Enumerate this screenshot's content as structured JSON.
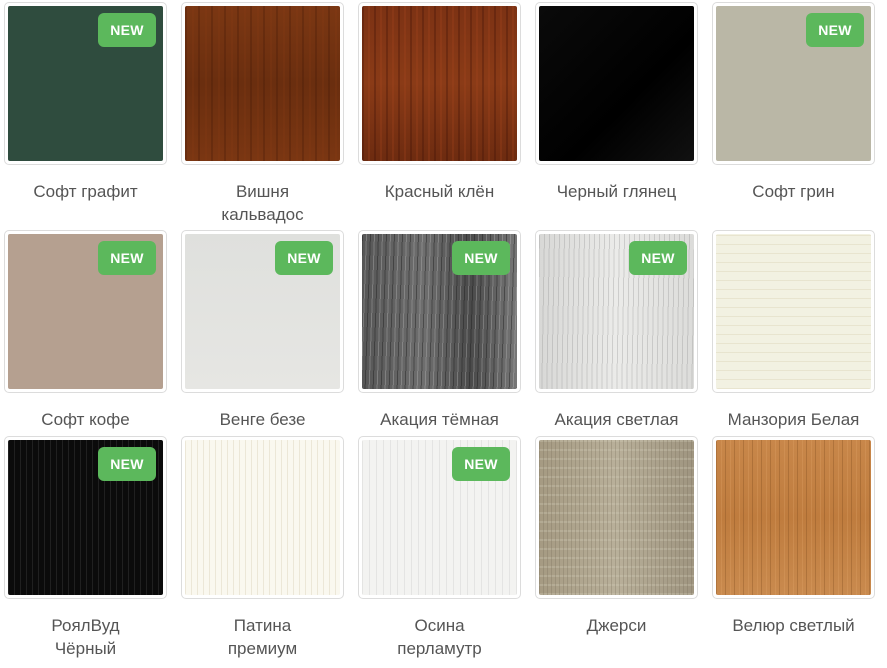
{
  "badge_text": "NEW",
  "badge_color": "#5cb85c",
  "swatches": [
    {
      "label": "Софт графит",
      "new": true,
      "color": "#2f4c3e"
    },
    {
      "label": "Вишня\nкальвадос",
      "new": false,
      "color": "#763412"
    },
    {
      "label": "Красный клён",
      "new": false,
      "color": "#7c3214"
    },
    {
      "label": "Черный глянец",
      "new": false,
      "color": "#000000"
    },
    {
      "label": "Софт грин",
      "new": true,
      "color": "#bab7a6"
    },
    {
      "label": "Софт кофе",
      "new": true,
      "color": "#b5a090"
    },
    {
      "label": "Венге безе",
      "new": true,
      "color": "#e2e3e0"
    },
    {
      "label": "Акация тёмная",
      "new": true,
      "color": "#5e5e5e"
    },
    {
      "label": "Акация светлая",
      "new": true,
      "color": "#e0e0de"
    },
    {
      "label": "Манзория Белая",
      "new": false,
      "color": "#f2f1e2"
    },
    {
      "label": "РоялВуд\nЧёрный",
      "new": true,
      "color": "#0b0b0b"
    },
    {
      "label": "Патина\nпремиум",
      "new": false,
      "color": "#faf8ef"
    },
    {
      "label": "Осина\nперламутр",
      "new": true,
      "color": "#f3f3f1"
    },
    {
      "label": "Джерси",
      "new": false,
      "color": "#aea48d"
    },
    {
      "label": "Велюр светлый",
      "new": false,
      "color": "#c4834a"
    }
  ]
}
